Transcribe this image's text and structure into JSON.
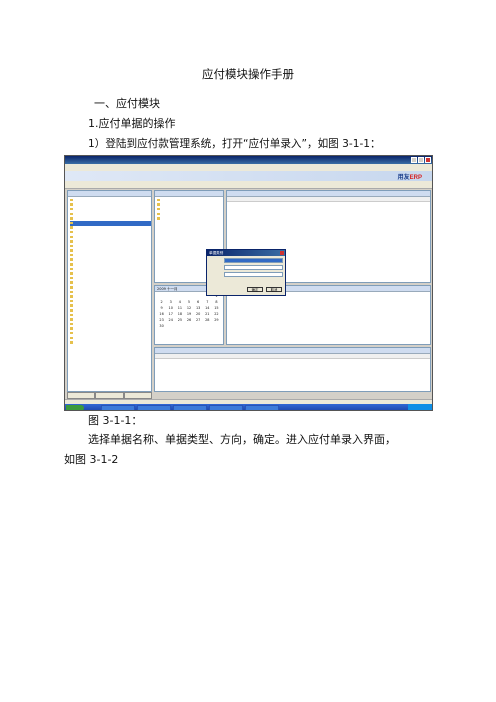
{
  "document": {
    "title": "应付模块操作手册",
    "section_heading": "一、应付模块",
    "subsection_heading": "1.应付单据的操作",
    "step_text": "1）登陆到应付款管理系统，打开“应付单录入”，如图 3-1-1：",
    "figure_caption": "图 3-1-1：",
    "body_line1": "选择单据名称、单据类型、方向，确定。进入应付单录入界面，",
    "body_line2": "如图 3-1-2"
  },
  "screenshot": {
    "logo_prefix": "用友",
    "logo_suffix": "ERP",
    "calendar_year": "2009",
    "calendar_month": "十一月",
    "calendar_days": [
      "1",
      "2",
      "3",
      "4",
      "5",
      "6",
      "7",
      "8",
      "9",
      "10",
      "11",
      "12",
      "13",
      "14",
      "15",
      "16",
      "17",
      "18",
      "19",
      "20",
      "21",
      "22",
      "23",
      "24",
      "25",
      "26",
      "27",
      "28",
      "29",
      "30"
    ],
    "dialog_title": "单据类别",
    "dialog_ok": "确定",
    "dialog_cancel": "取消",
    "colors": {
      "title_bar": "#0a246a",
      "selection": "#316ac5",
      "taskbar": "#3168d5",
      "start_button": "#3c9a3c",
      "logo": "#1a3d8a",
      "logo_accent": "#d62020"
    }
  }
}
